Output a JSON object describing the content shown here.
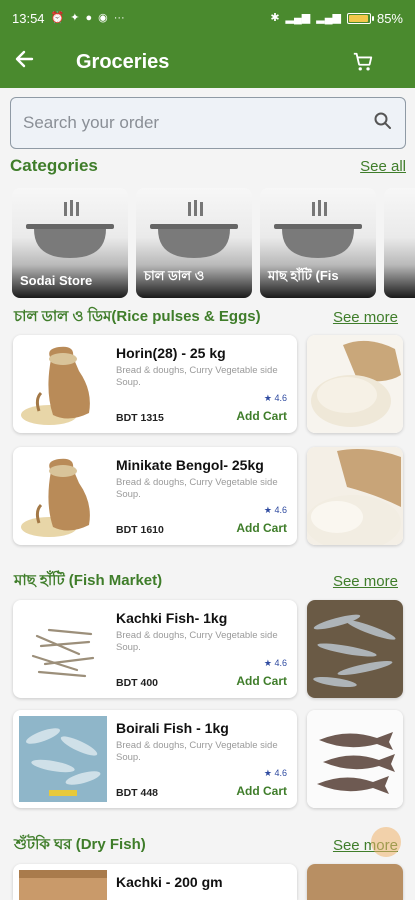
{
  "status_bar": {
    "time": "13:54",
    "battery": "85%",
    "battery_level": 0.85
  },
  "app_bar": {
    "title": "Groceries",
    "back_icon": "arrow-back-icon",
    "cart_icon": "cart-icon"
  },
  "search": {
    "placeholder": "Search your order",
    "icon": "search-icon"
  },
  "categories": {
    "title": "Categories",
    "see_all": "See all",
    "items": [
      {
        "label": "Sodai Store"
      },
      {
        "label": "চাল ডাল ও"
      },
      {
        "label": "মাছ হাঁটি (Fis"
      }
    ]
  },
  "sections": [
    {
      "title": "চাল ডাল ও ডিম(Rice pulses & Eggs)",
      "see_more": "See more",
      "products": [
        {
          "name": "Horin(28) - 25 kg",
          "desc": "Bread & doughs, Curry Vegetable side Soup.",
          "rating": "4.6",
          "price": "BDT 1315",
          "add": "Add Cart"
        },
        {
          "name": "Minikate Bengol- 25kg",
          "desc": "Bread & doughs, Curry Vegetable side Soup.",
          "rating": "4.6",
          "price": "BDT 1610",
          "add": "Add Cart"
        }
      ]
    },
    {
      "title": "মাছ হাঁটি (Fish Market)",
      "see_more": "See more",
      "products": [
        {
          "name": "Kachki Fish- 1kg",
          "desc": "Bread & doughs, Curry Vegetable side Soup.",
          "rating": "4.6",
          "price": "BDT 400",
          "add": "Add Cart"
        },
        {
          "name": "Boirali Fish - 1kg",
          "desc": "Bread & doughs, Curry Vegetable side Soup.",
          "rating": "4.6",
          "price": "BDT 448",
          "add": "Add Cart"
        }
      ]
    },
    {
      "title": "শুঁটকি ঘর (Dry Fish)",
      "see_more": "See more",
      "products": [
        {
          "name": "Kachki - 200 gm"
        }
      ]
    }
  ],
  "colors": {
    "brand": "#4a8a2e",
    "accent_text": "#3f7d2a"
  }
}
